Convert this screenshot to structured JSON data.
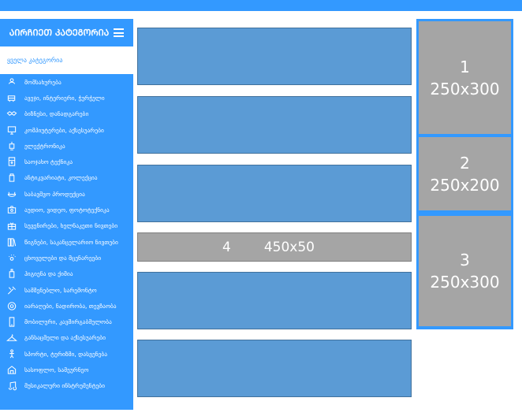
{
  "colors": {
    "accent": "#3399ff",
    "banner_blue": "#5b9bd5",
    "banner_gray": "#a5a5a5"
  },
  "sidebar": {
    "title": "ᲐᲘᲠᲩᲘᲔᲗ ᲙᲐᲢᲔᲒᲝᲠᲘᲐ",
    "menu_icon": "hamburger-icon",
    "all_label": "ყველა კატეგორია",
    "items": [
      {
        "label": "მომსახურება",
        "icon": "service-icon"
      },
      {
        "label": "ავეჯი, ინტერიერი, ჭურჭელი",
        "icon": "furniture-icon"
      },
      {
        "label": "ბიზნესი, დანადგარები",
        "icon": "handshake-icon"
      },
      {
        "label": "კომპიუტერები, აქსესუარები",
        "icon": "computer-icon"
      },
      {
        "label": "ელექტრონიკა",
        "icon": "electronics-icon"
      },
      {
        "label": "საოჯახო ტექნიკა",
        "icon": "appliance-icon"
      },
      {
        "label": "ანტიკვარიატი, კოლექცია",
        "icon": "antique-icon"
      },
      {
        "label": "საბავშვო პროდუქცია",
        "icon": "baby-icon"
      },
      {
        "label": "აუდიო, ვიდეო, ფოტოტექნიკა",
        "icon": "camera-icon"
      },
      {
        "label": "სუვენირები, ხელნაკეთი ნივთები",
        "icon": "gift-icon"
      },
      {
        "label": "წიგნები, საკანცელარიო ნივთები",
        "icon": "books-icon"
      },
      {
        "label": "ცხოველები და მცენარეები",
        "icon": "paw-icon"
      },
      {
        "label": "ჰიგიენა და ქიმია",
        "icon": "hygiene-icon"
      },
      {
        "label": "სამშენებლო, სარემონტო",
        "icon": "tools-icon"
      },
      {
        "label": "იარაღები, ნადირობა, თევზაობა",
        "icon": "target-icon"
      },
      {
        "label": "მობილური, კავშირგაბმულობა",
        "icon": "phone-icon"
      },
      {
        "label": "განსაცმელი და აქსესუარები",
        "icon": "hanger-icon"
      },
      {
        "label": "სპორტი, ტურიზმი, დასვენება",
        "icon": "sport-icon"
      },
      {
        "label": "სასოფლო, სამეურნეო",
        "icon": "farm-icon"
      },
      {
        "label": "მუსიკალური ინსტრუმენტები",
        "icon": "music-icon"
      }
    ]
  },
  "banners": {
    "placeholder": {
      "number": "4",
      "size": "450x50"
    }
  },
  "right_ads": [
    {
      "number": "1",
      "size": "250x300"
    },
    {
      "number": "2",
      "size": "250x200"
    },
    {
      "number": "3",
      "size": "250x300"
    }
  ]
}
